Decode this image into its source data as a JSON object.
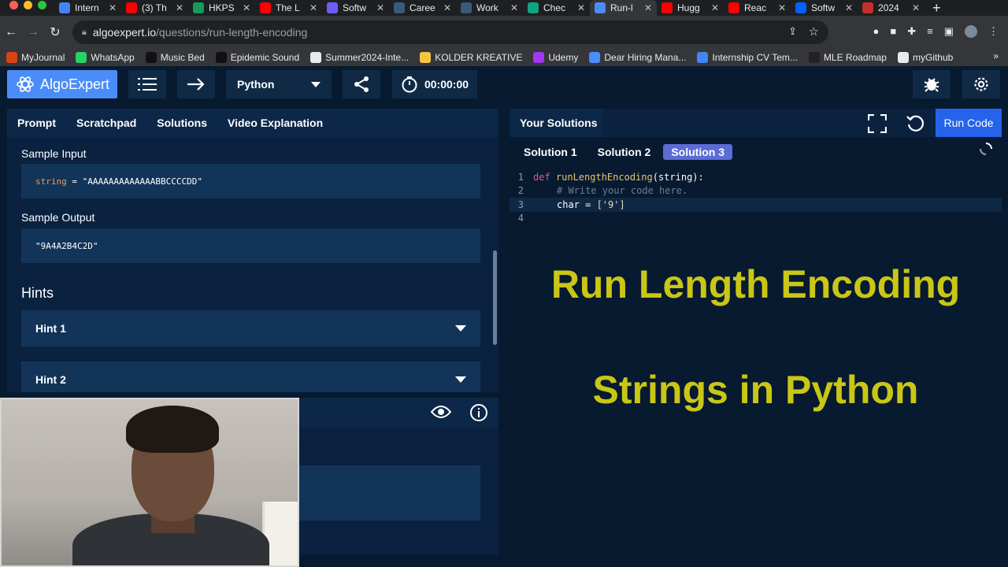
{
  "browser": {
    "tabs": [
      {
        "title": "Intern",
        "color": "#4285f4"
      },
      {
        "title": "(3) Th",
        "color": "#ff0000"
      },
      {
        "title": "HKPS",
        "color": "#0f9d58"
      },
      {
        "title": "The L",
        "color": "#ff0000"
      },
      {
        "title": "Softw",
        "color": "#6d5dfc"
      },
      {
        "title": "Caree",
        "color": "#3a5a7a"
      },
      {
        "title": "Work",
        "color": "#3a5a7a"
      },
      {
        "title": "Chec",
        "color": "#10a37f"
      },
      {
        "title": "Run-l",
        "color": "#4b8df8",
        "active": true
      },
      {
        "title": "Hugg",
        "color": "#ff0000"
      },
      {
        "title": "Reac",
        "color": "#ff0000"
      },
      {
        "title": "Softw",
        "color": "#0061fe"
      },
      {
        "title": "2024",
        "color": "#c4302b"
      }
    ],
    "url_host": "algoexpert.io",
    "url_path": "/questions/run-length-encoding",
    "bookmarks": [
      {
        "label": "MyJournal",
        "color": "#d84315"
      },
      {
        "label": "WhatsApp",
        "color": "#25d366"
      },
      {
        "label": "Music Bed",
        "color": "#111111"
      },
      {
        "label": "Epidemic Sound",
        "color": "#111111"
      },
      {
        "label": "Summer2024-Inte...",
        "color": "#e8eaed"
      },
      {
        "label": "KOLDER KREATIVE",
        "color": "#f4c542"
      },
      {
        "label": "Udemy",
        "color": "#a435f0"
      },
      {
        "label": "Dear Hiring Mana...",
        "color": "#4b8df8"
      },
      {
        "label": "Internship CV Tem...",
        "color": "#4285f4"
      },
      {
        "label": "MLE Roadmap",
        "color": "#222222"
      },
      {
        "label": "myGithub",
        "color": "#e8eaed"
      }
    ]
  },
  "app": {
    "logo": "AlgoExpert",
    "language": "Python",
    "timer": "00:00:00"
  },
  "left": {
    "tabs": [
      "Prompt",
      "Scratchpad",
      "Solutions",
      "Video Explanation"
    ],
    "sample_input_label": "Sample Input",
    "sample_input_var": "string",
    "sample_input_eq": " = ",
    "sample_input_value": "\"AAAAAAAAAAAAABBCCCCDD\"",
    "sample_output_label": "Sample Output",
    "sample_output_value": "\"9A4A2B4C2D\"",
    "hints_title": "Hints",
    "hint1": "Hint 1",
    "hint2": "Hint 2"
  },
  "right": {
    "header": "Your Solutions",
    "run_label": "Run Code",
    "solution_tabs": [
      "Solution 1",
      "Solution 2",
      "Solution 3"
    ],
    "code": {
      "line1_kw": "def ",
      "line1_fn": "runLengthEncoding",
      "line1_rest": "(string):",
      "line2_comment": "# Write your code here.",
      "line3_var": "char = ",
      "line3_val": "['9']"
    },
    "overlay_line1": "Run Length Encoding",
    "overlay_line2": "Strings in Python"
  },
  "colors": {
    "accent": "#4b8df8",
    "overlay_text": "#c9c616",
    "run_button": "#2563eb"
  }
}
